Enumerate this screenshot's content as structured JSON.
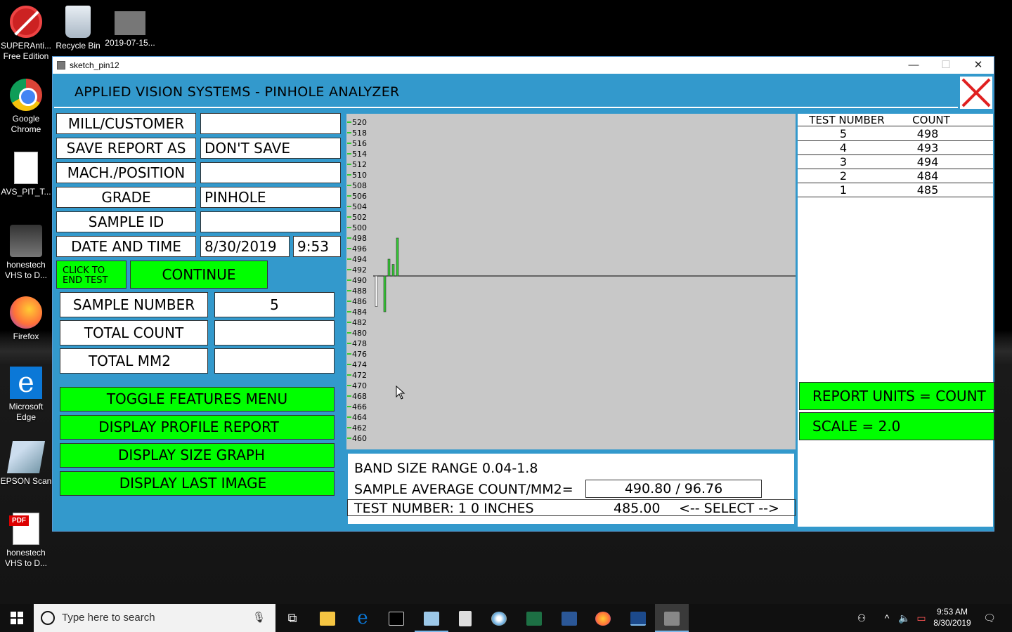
{
  "desktop": {
    "icons": [
      {
        "label": "SUPERAnti...\nFree Edition",
        "line1": "SUPERAnti...",
        "line2": "Free Edition"
      },
      {
        "line1": "Recycle Bin",
        "line2": ""
      },
      {
        "line1": "2019-07-15...",
        "line2": ""
      },
      {
        "line1": "Google",
        "line2": "Chrome"
      },
      {
        "line1": "AVS_PIT_T...",
        "line2": ""
      },
      {
        "line1": "honestech",
        "line2": "VHS to D..."
      },
      {
        "line1": "Firefox",
        "line2": ""
      },
      {
        "line1": "Microsoft",
        "line2": "Edge"
      },
      {
        "line1": "EPSON Scan",
        "line2": ""
      },
      {
        "line1": "honestech",
        "line2": "VHS to D..."
      }
    ],
    "pdf_badge": "PDF"
  },
  "window": {
    "title": "sketch_pin12",
    "minimize": "—",
    "maximize": "☐",
    "close": "✕"
  },
  "app": {
    "header": "APPLIED VISION SYSTEMS - PINHOLE ANALYZER",
    "form": {
      "mill_label": "MILL/CUSTOMER",
      "mill_value": "",
      "save_label": "SAVE REPORT AS",
      "save_value": "DON'T SAVE",
      "mach_label": "MACH./POSITION",
      "mach_value": "",
      "grade_label": "GRADE",
      "grade_value": "PINHOLE",
      "sample_id_label": "SAMPLE ID",
      "sample_id_value": "",
      "datetime_label": "DATE AND TIME",
      "date_value": "8/30/2019",
      "time_value": "9:53"
    },
    "end_test_line1": "CLICK TO",
    "end_test_line2": "END  TEST",
    "continue": "CONTINUE",
    "sample_number_label": "SAMPLE NUMBER",
    "sample_number_value": "5",
    "total_count_label": "TOTAL COUNT",
    "total_count_value": "",
    "total_mm2_label": "TOTAL MM2",
    "total_mm2_value": "",
    "menu_buttons": [
      "TOGGLE FEATURES MENU",
      "DISPLAY PROFILE REPORT",
      "DISPLAY SIZE GRAPH",
      "DISPLAY LAST IMAGE"
    ],
    "band_size_range": "BAND SIZE RANGE  0.04-1.8",
    "sample_avg_label": "SAMPLE AVERAGE COUNT/MM2=",
    "sample_avg_value": "490.80 / 96.76",
    "test_number_line": "TEST NUMBER: 1  0 INCHES",
    "test_value": "485.00",
    "select": "<-- SELECT -->",
    "table": {
      "headers": [
        "TEST NUMBER",
        "COUNT"
      ],
      "rows": [
        [
          "5",
          "498"
        ],
        [
          "4",
          "493"
        ],
        [
          "3",
          "494"
        ],
        [
          "2",
          "484"
        ],
        [
          "1",
          "485"
        ]
      ]
    },
    "report_units": "REPORT UNITS = COUNT",
    "scale": "SCALE = 2.0"
  },
  "chart_data": {
    "type": "bar",
    "y_ticks": [
      520,
      518,
      516,
      514,
      512,
      510,
      508,
      506,
      504,
      502,
      500,
      498,
      496,
      494,
      492,
      490,
      488,
      486,
      484,
      482,
      480,
      478,
      476,
      474,
      472,
      470,
      468,
      466,
      464,
      462,
      460
    ],
    "ylim": [
      460,
      520
    ],
    "baseline": 490.8,
    "categories": [
      "1",
      "2",
      "3",
      "4",
      "5"
    ],
    "values": [
      485,
      484,
      494,
      493,
      498
    ],
    "colors": {
      "bar": "#33cc33",
      "selected_bar": "#ffffff",
      "bg": "#c8c8c8"
    }
  },
  "taskbar": {
    "search_placeholder": "Type here to search",
    "time": "9:53 AM",
    "date": "8/30/2019"
  }
}
